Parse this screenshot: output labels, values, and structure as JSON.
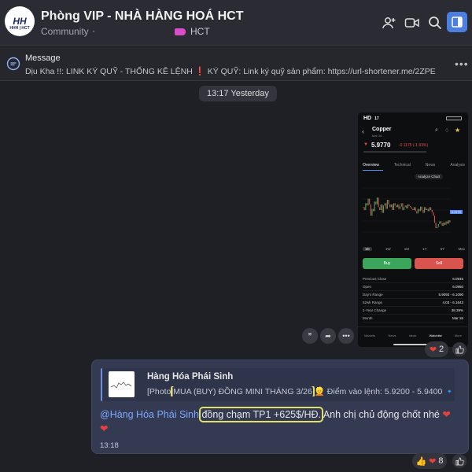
{
  "header": {
    "title": "Phòng VIP - NHÀ HÀNG HOÁ HCT",
    "subtitle": "Community",
    "tag_label": "HCT",
    "avatar_text": "HH",
    "avatar_sub": "HHH | HCT"
  },
  "pinned": {
    "title": "Message",
    "content": "Dịu Kha !!: LINK KÝ QUỸ - THỐNG KÊ LỆNH ❗️ KÝ QUỸ: Link ký quỹ sản phẩm: https://url-shortener.me/2ZPE ❗️..."
  },
  "date_divider": "13:17 Yesterday",
  "photo_message": {
    "phone": {
      "status_left": "HD",
      "status_time": "17",
      "symbol": "Copper",
      "symbol_sub": "Mar 26",
      "price": "5.9770",
      "change": "-0.1175 (-1.93%)",
      "tabs": [
        "Overview",
        "Technical",
        "News",
        "Analysis"
      ],
      "analyze_label": "Analyze Chart",
      "price_tag": "5.9770",
      "ranges": [
        "1D",
        "1W",
        "1M",
        "1Y",
        "5Y",
        "Max"
      ],
      "buy_label": "Buy",
      "sell_label": "Sell",
      "stats": [
        {
          "label": "Previous Close",
          "value": "6.0945"
        },
        {
          "label": "Open",
          "value": "6.0950"
        },
        {
          "label": "Day's Range",
          "value": "5.9093 - 6.1090"
        },
        {
          "label": "52wk Range",
          "value": "4.03 - 6.1643"
        },
        {
          "label": "1-Year Change",
          "value": "38.39%"
        },
        {
          "label": "Month",
          "value": "Mar 26"
        }
      ],
      "nav": [
        "Markets",
        "News",
        "Ideas",
        "Watchlist",
        "More"
      ]
    },
    "reaction_count": "2"
  },
  "reply_message": {
    "quoted_name": "Hàng Hóa Phái Sinh",
    "quoted_prefix": "[Photo]",
    "quoted_highlight": "MUA (BUY) ĐỒNG MINI THÁNG 3/26",
    "quoted_rest": "👱 Điểm vào lệnh: 5.9200 - 5.9400 🔹...",
    "mention": "@Hàng Hóa Phái Sinh",
    "highlight": "đồng chạm TP1 +625$/HĐ.",
    "rest": " Anh chị chủ động chốt nhé",
    "time": "13:18",
    "reaction_count": "8"
  },
  "colors": {
    "accent": "#4d7fe0",
    "highlight_box": "#e3e06a",
    "mention": "#7ea7ff",
    "buy": "#3ba55c",
    "sell": "#d9534f"
  },
  "chart_series": [
    0.55,
    0.5,
    0.62,
    0.58,
    0.7,
    0.6,
    0.4,
    0.52,
    0.48,
    0.65,
    0.6,
    0.72,
    0.55,
    0.5,
    0.6,
    0.45,
    0.58,
    0.62,
    0.52,
    0.68,
    0.6,
    0.55,
    0.6,
    0.5,
    0.62,
    0.58,
    0.55,
    0.6,
    0.52,
    0.56,
    0.62,
    0.5,
    0.55,
    0.58,
    0.53,
    0.6,
    0.57,
    0.55,
    0.52,
    0.5,
    0.55,
    0.48,
    0.44,
    0.52,
    0.48,
    0.56,
    0.5,
    0.45,
    0.55,
    0.5,
    0.52,
    0.48,
    0.55,
    0.5,
    0.46,
    0.4,
    0.28,
    0.18,
    0.2,
    0.25,
    0.3,
    0.27,
    0.22,
    0.28,
    0.24,
    0.3,
    0.26,
    0.32,
    0.28
  ]
}
